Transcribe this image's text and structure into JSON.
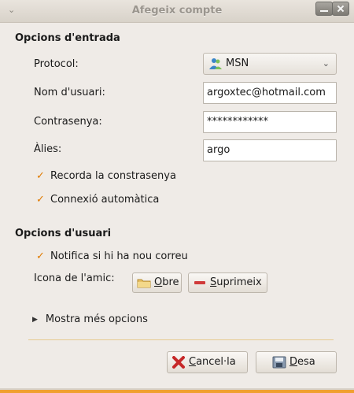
{
  "window": {
    "title": "Afegeix compte"
  },
  "entry_options": {
    "section_title": "Opcions d'entrada",
    "protocol_label": "Protocol:",
    "protocol_value": "MSN",
    "protocol_icon": "msn-buddy-icon",
    "username_label": "Nom d'usuari:",
    "username_value": "argoxtec@hotmail.com",
    "password_label": "Contrasenya:",
    "password_value": "************",
    "alias_label": "Àlies:",
    "alias_value": "argo",
    "remember_password": {
      "label": "Recorda la constrasenya",
      "checked": true
    },
    "auto_connect": {
      "label": "Connexió automàtica",
      "checked": true
    }
  },
  "user_options": {
    "section_title": "Opcions d'usuari",
    "notify_mail": {
      "label": "Notifica si hi ha nou correu",
      "checked": true
    },
    "buddy_icon_label": "Icona de l'amic:",
    "open_button": {
      "mnemonic": "O",
      "rest": "bre"
    },
    "remove_button": {
      "mnemonic": "S",
      "rest": "uprimeix"
    }
  },
  "more_options": {
    "label": "Mostra més opcions",
    "expanded": false
  },
  "footer": {
    "cancel_button": {
      "mnemonic": "C",
      "rest": "ancel·la"
    },
    "save_button": {
      "mnemonic": "D",
      "rest": "esa"
    }
  },
  "colors": {
    "accent": "#e07a00",
    "window_bg": "#efebe7",
    "separator": "#e6c98e"
  }
}
